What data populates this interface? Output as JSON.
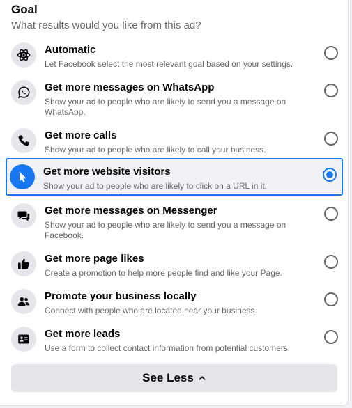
{
  "goal": {
    "title": "Goal",
    "subtitle": "What results would you like from this ad?"
  },
  "options": [
    {
      "icon": "atom-icon",
      "title": "Automatic",
      "description": "Let Facebook select the most relevant goal based on your settings.",
      "selected": false
    },
    {
      "icon": "whatsapp-icon",
      "title": "Get more messages on WhatsApp",
      "description": "Show your ad to people who are likely to send you a message on WhatsApp.",
      "selected": false
    },
    {
      "icon": "phone-icon",
      "title": "Get more calls",
      "description": "Show your ad to people who are likely to call your business.",
      "selected": false
    },
    {
      "icon": "cursor-icon",
      "title": "Get more website visitors",
      "description": "Show your ad to people who are likely to click on a URL in it.",
      "selected": true
    },
    {
      "icon": "messenger-chat-icon",
      "title": "Get more messages on Messenger",
      "description": "Show your ad to people who are likely to send you a message on Facebook.",
      "selected": false
    },
    {
      "icon": "thumbs-up-icon",
      "title": "Get more page likes",
      "description": "Create a promotion to help more people find and like your Page.",
      "selected": false
    },
    {
      "icon": "people-icon",
      "title": "Promote your business locally",
      "description": "Connect with people who are located near your business.",
      "selected": false
    },
    {
      "icon": "contact-card-icon",
      "title": "Get more leads",
      "description": "Use a form to collect contact information from potential customers.",
      "selected": false
    }
  ],
  "footer": {
    "see_less_label": "See Less",
    "chevron_icon": "chevron-up-icon"
  },
  "colors": {
    "accent": "#1877f2",
    "text_primary": "#050505",
    "text_secondary": "#65676b",
    "button_bg": "#e4e6eb"
  }
}
